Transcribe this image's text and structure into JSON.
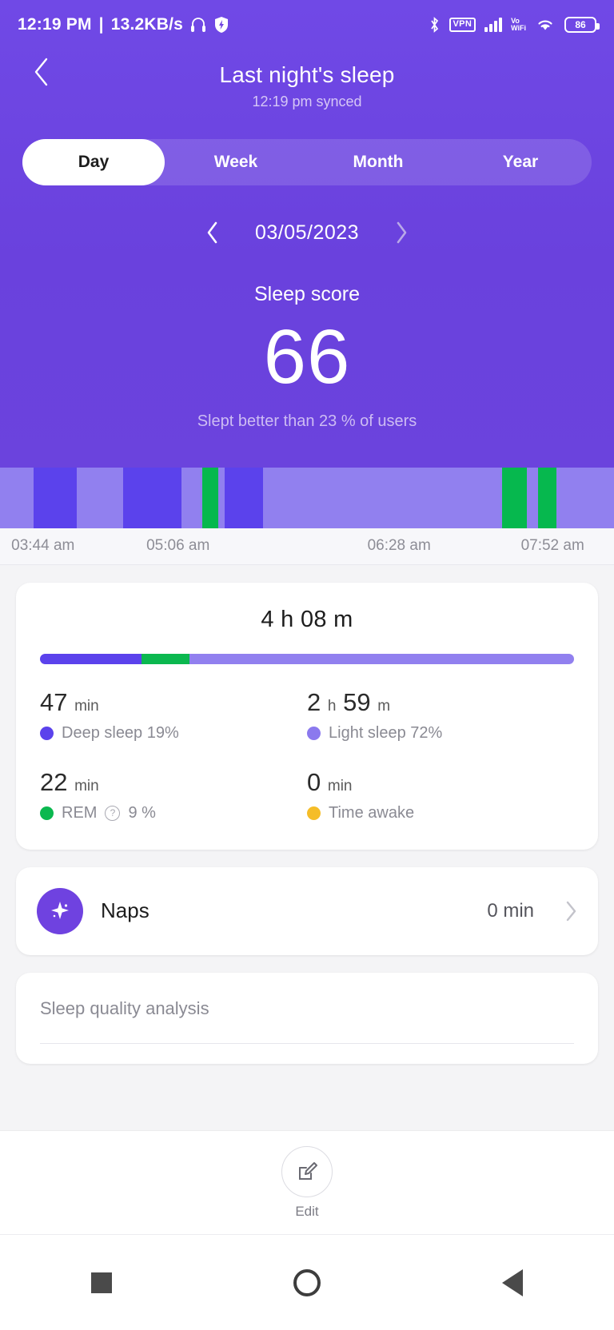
{
  "status_bar": {
    "time": "12:19 PM",
    "separator": "|",
    "network_speed": "13.2KB/s",
    "headset_icon": "headset-icon",
    "shield_icon": "shield-icon",
    "bluetooth_icon": "bluetooth-icon",
    "vpn_label": "VPN",
    "signal_icon": "signal-bars-icon",
    "volte_line1": "Vo",
    "volte_line2": "WiFi",
    "wifi_icon": "wifi-icon",
    "battery_level": "86"
  },
  "header": {
    "back_icon": "back-chevron-icon",
    "title": "Last night's sleep",
    "subtitle": "12:19 pm synced"
  },
  "tabs": {
    "items": [
      {
        "label": "Day",
        "active": true
      },
      {
        "label": "Week",
        "active": false
      },
      {
        "label": "Month",
        "active": false
      },
      {
        "label": "Year",
        "active": false
      }
    ]
  },
  "date_nav": {
    "prev_icon": "chevron-left-icon",
    "date": "03/05/2023",
    "next_icon": "chevron-right-icon"
  },
  "sleep_score": {
    "title": "Sleep score",
    "value": "66",
    "note": "Slept better than 23 % of users"
  },
  "chart_data": {
    "type": "bar",
    "title": "Sleep stages hypnogram",
    "xlabel": "",
    "ylabel": "",
    "grid": false,
    "legend_position": "below-card",
    "x_tick_labels": [
      "03:44 am",
      "05:06 am",
      "06:28 am",
      "07:52 am"
    ],
    "x_tick_positions_pct": [
      7,
      29,
      65,
      90
    ],
    "stage_colors": {
      "deep": "#5b42ec",
      "light": "#9180ef",
      "rem": "#06b84e",
      "awake": "#f5bd28"
    },
    "segments": [
      {
        "stage": "light",
        "width_pct": 5.5
      },
      {
        "stage": "deep",
        "width_pct": 7.0
      },
      {
        "stage": "light",
        "width_pct": 7.5
      },
      {
        "stage": "deep",
        "width_pct": 9.5
      },
      {
        "stage": "light",
        "width_pct": 3.5
      },
      {
        "stage": "rem",
        "width_pct": 2.6
      },
      {
        "stage": "light",
        "width_pct": 1.0
      },
      {
        "stage": "deep",
        "width_pct": 6.2
      },
      {
        "stage": "light",
        "width_pct": 39.0
      },
      {
        "stage": "rem",
        "width_pct": 4.0
      },
      {
        "stage": "light",
        "width_pct": 1.8
      },
      {
        "stage": "rem",
        "width_pct": 3.0
      },
      {
        "stage": "light",
        "width_pct": 9.4
      }
    ]
  },
  "duration_card": {
    "total": "4 h 08 m",
    "stack": [
      {
        "name": "Deep sleep",
        "percent": 19,
        "color": "#5b42ec"
      },
      {
        "name": "REM",
        "percent": 9,
        "color": "#0bb84f"
      },
      {
        "name": "Light sleep",
        "percent": 72,
        "color": "#9180ef"
      }
    ],
    "stats": [
      {
        "value": "47",
        "unit": "min",
        "label": "Deep sleep 19%",
        "dot_color": "#5b42ec",
        "has_info_icon": false,
        "info_icon": "",
        "label_suffix": ""
      },
      {
        "value": "2",
        "unit": "h",
        "value2": "59",
        "unit2": "m",
        "label": "Light sleep 72%",
        "dot_color": "#8b79ee",
        "has_info_icon": false,
        "info_icon": "",
        "label_suffix": ""
      },
      {
        "value": "22",
        "unit": "min",
        "label": "REM",
        "dot_color": "#0bb84f",
        "has_info_icon": true,
        "info_icon": "help-circle-icon",
        "label_suffix": "9 %"
      },
      {
        "value": "0",
        "unit": "min",
        "label": "Time awake",
        "dot_color": "#f5bd28",
        "has_info_icon": false,
        "info_icon": "",
        "label_suffix": ""
      }
    ]
  },
  "naps_card": {
    "icon": "sparkle-star-icon",
    "label": "Naps",
    "value": "0 min",
    "chevron_icon": "chevron-right-icon"
  },
  "quality_card": {
    "title": "Sleep quality analysis"
  },
  "edit_bar": {
    "icon": "edit-pencil-square-icon",
    "label": "Edit"
  },
  "nav_bar": {
    "recents_icon": "square-recents-icon",
    "home_icon": "circle-home-icon",
    "back_icon": "triangle-back-icon"
  }
}
